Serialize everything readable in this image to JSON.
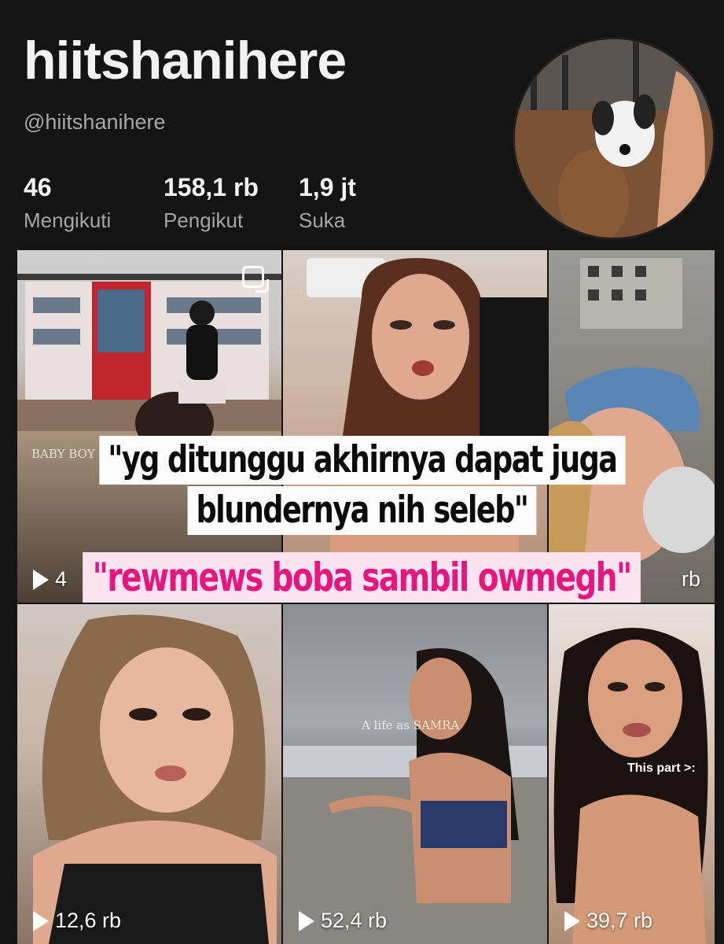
{
  "profile": {
    "display_name": "hiitshanihere",
    "username": "@hiitshanihere",
    "stats": [
      {
        "value": "46",
        "label": "Mengikuti"
      },
      {
        "value": "158,1 rb",
        "label": "Pengikut"
      },
      {
        "value": "1,9 jt",
        "label": "Suka"
      }
    ]
  },
  "videos": [
    {
      "views": "4",
      "watermark": "BABY BOY",
      "pinned": true
    },
    {
      "views": ""
    },
    {
      "views": "rb"
    },
    {
      "views": "12,6 rb"
    },
    {
      "views": "52,4 rb",
      "watermark": "A life as SAMRA"
    },
    {
      "views": "39,7 rb",
      "overlay": "This part >:"
    }
  ],
  "captions": {
    "line1": "\"yg ditunggu akhirnya dapat juga",
    "line2": "blundernya nih seleb\"",
    "line3": "\"rewmews boba sambil  owmegh\""
  },
  "colors": {
    "background": "#141414",
    "pink_text": "#e6167e",
    "pink_bg": "#fbe3f0"
  }
}
